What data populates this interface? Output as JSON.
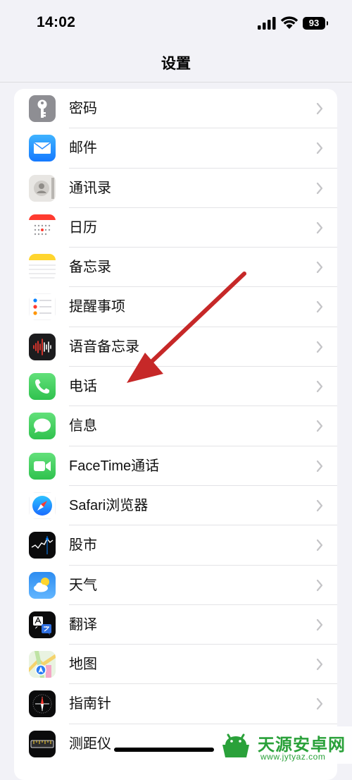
{
  "status_bar": {
    "time": "14:02",
    "battery": "93"
  },
  "nav": {
    "title": "设置"
  },
  "settings": {
    "items": [
      {
        "label": "密码",
        "icon": "key-icon"
      },
      {
        "label": "邮件",
        "icon": "mail-icon"
      },
      {
        "label": "通讯录",
        "icon": "contacts-icon"
      },
      {
        "label": "日历",
        "icon": "calendar-icon"
      },
      {
        "label": "备忘录",
        "icon": "notes-icon"
      },
      {
        "label": "提醒事项",
        "icon": "reminders-icon"
      },
      {
        "label": "语音备忘录",
        "icon": "voice-memos-icon"
      },
      {
        "label": "电话",
        "icon": "phone-icon"
      },
      {
        "label": "信息",
        "icon": "messages-icon"
      },
      {
        "label": "FaceTime通话",
        "icon": "facetime-icon"
      },
      {
        "label": "Safari浏览器",
        "icon": "safari-icon"
      },
      {
        "label": "股市",
        "icon": "stocks-icon"
      },
      {
        "label": "天气",
        "icon": "weather-icon"
      },
      {
        "label": "翻译",
        "icon": "translate-icon"
      },
      {
        "label": "地图",
        "icon": "maps-icon"
      },
      {
        "label": "指南针",
        "icon": "compass-icon"
      },
      {
        "label": "测距仪",
        "icon": "measure-icon"
      }
    ]
  },
  "watermark": {
    "title": "天源安卓网",
    "url": "www.jytyaz.com"
  },
  "colors": {
    "accent_arrow": "#c62828",
    "background": "#f2f2f7",
    "watermark": "#2aa13a"
  }
}
